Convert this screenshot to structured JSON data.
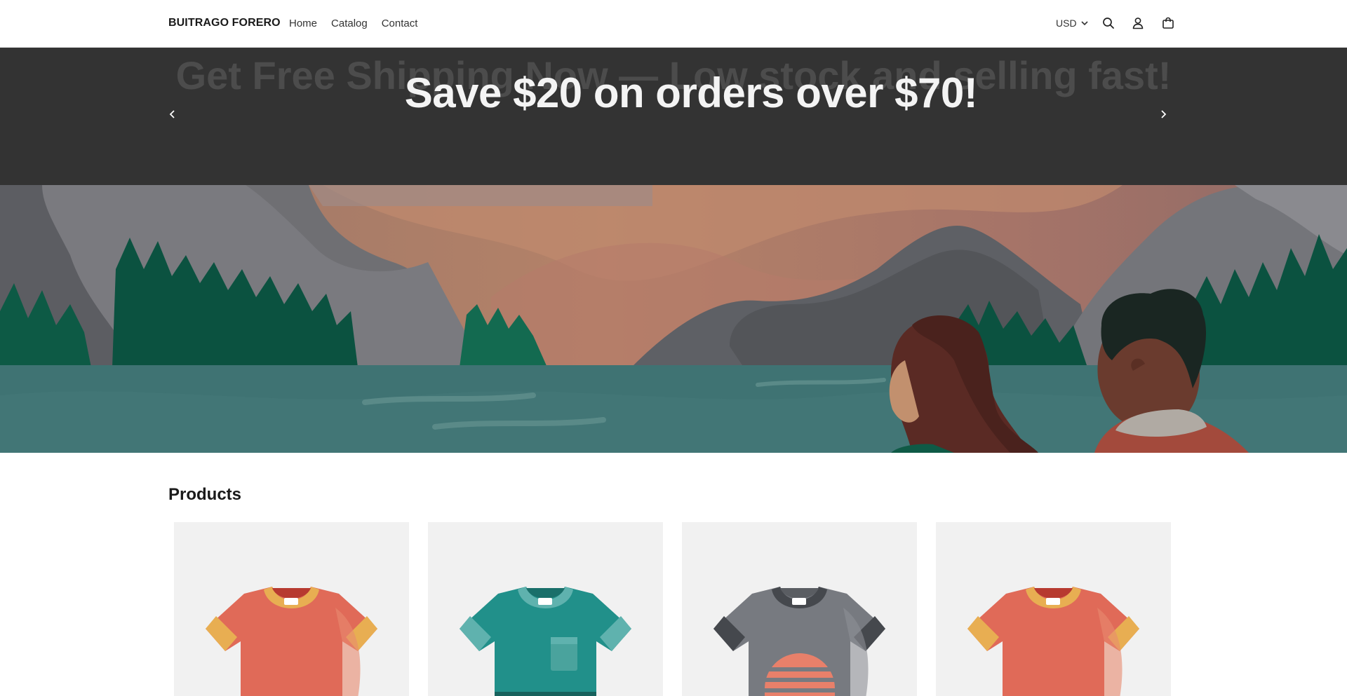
{
  "header": {
    "brand": "BUITRAGO FORERO",
    "nav": [
      {
        "label": "Home"
      },
      {
        "label": "Catalog"
      },
      {
        "label": "Contact"
      }
    ],
    "currency": "USD",
    "icons": [
      "search-icon",
      "account-icon",
      "cart-icon"
    ]
  },
  "announcement": {
    "previous_slide": "Get Free Shipping Now — Low stock and selling fast!",
    "current_slide": "Save $20 on orders over $70!"
  },
  "products": {
    "title": "Products",
    "items": [
      {
        "shirt_color": "#e06a58",
        "trim": "#e8ae52",
        "graphic": "none"
      },
      {
        "shirt_color": "#21908a",
        "trim": "#5fb2ae",
        "graphic": "pocket"
      },
      {
        "shirt_color": "#777a80",
        "trim": "#45484d",
        "graphic": "sunset"
      },
      {
        "shirt_color": "#e06a58",
        "trim": "#e8ae52",
        "graphic": "none"
      }
    ]
  },
  "colors": {
    "announcement_bg": "#333333",
    "announcement_text": "#f4f4f4",
    "card_bg": "#f1f1f1"
  }
}
